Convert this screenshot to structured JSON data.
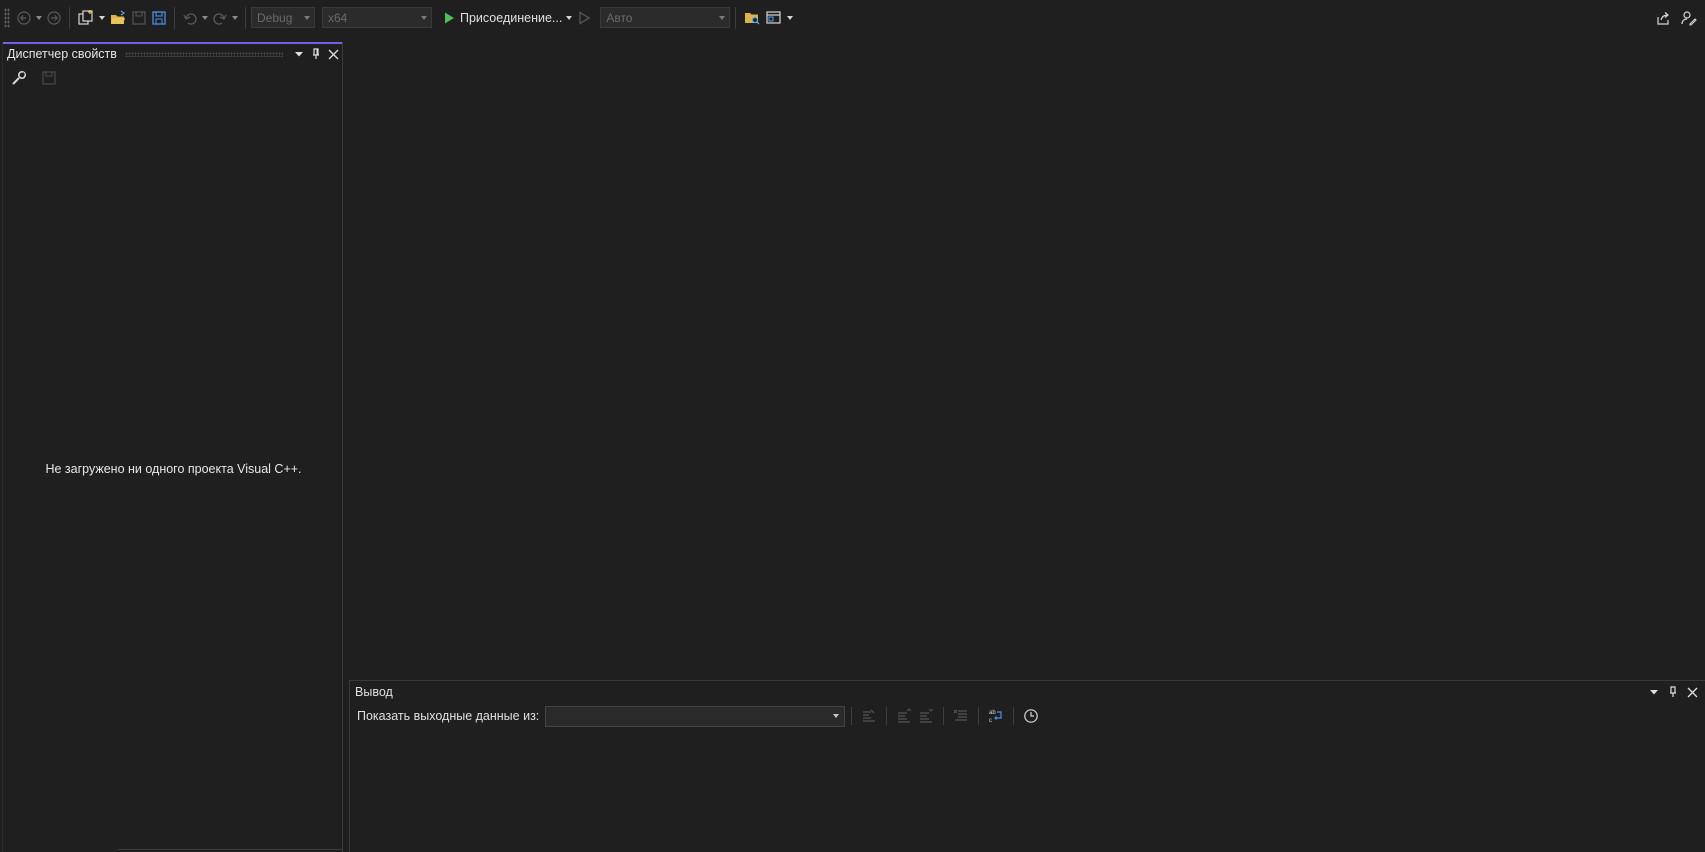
{
  "toolbar": {
    "configuration": "Debug",
    "platform": "x64",
    "run_label": "Присоединение...",
    "debug_target": "Авто"
  },
  "property_manager": {
    "title": "Диспетчер свойств",
    "empty_message": "Не загружено ни одного проекта Visual C++."
  },
  "output": {
    "title": "Вывод",
    "show_output_label": "Показать выходные данные из:",
    "source_value": ""
  },
  "colors": {
    "background": "#1f1f1f",
    "accent": "#7160e8",
    "run_green": "#4cbf5c"
  }
}
